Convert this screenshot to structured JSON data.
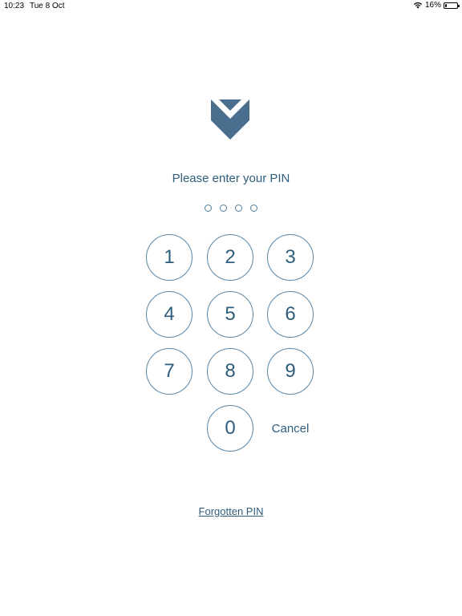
{
  "status_bar": {
    "time": "10:23",
    "date": "Tue 8 Oct",
    "battery_percent_label": "16%",
    "battery_level": 0.16,
    "icons": [
      "wifi-icon",
      "battery-icon"
    ]
  },
  "logo": {
    "icon": "chevron-shield-logo",
    "color": "#4a6f8e"
  },
  "prompt": "Please enter your PIN",
  "pin": {
    "length": 4,
    "entered": 0
  },
  "keypad": {
    "k1": "1",
    "k2": "2",
    "k3": "3",
    "k4": "4",
    "k5": "5",
    "k6": "6",
    "k7": "7",
    "k8": "8",
    "k9": "9",
    "k0": "0",
    "cancel": "Cancel"
  },
  "forgot_link": "Forgotten PIN",
  "colors": {
    "accent": "#2f5d7c",
    "border": "#5a86a6",
    "background": "#ffffff"
  }
}
